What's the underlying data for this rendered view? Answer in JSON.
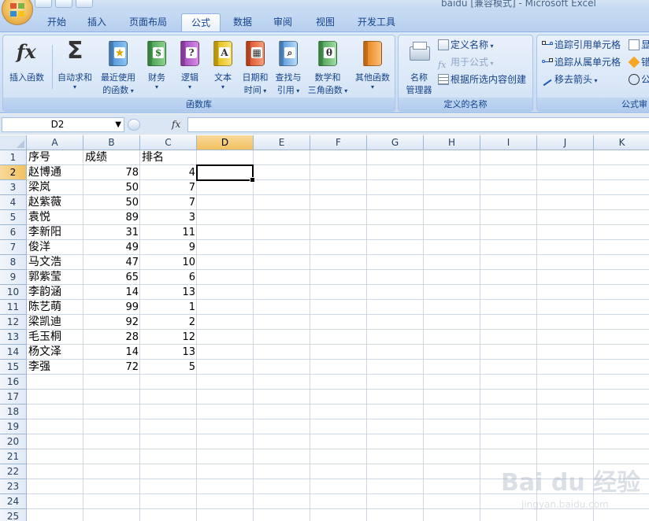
{
  "window": {
    "title": "baidu  [兼容模式] - Microsoft Excel"
  },
  "tabs": [
    {
      "label": "开始"
    },
    {
      "label": "插入"
    },
    {
      "label": "页面布局"
    },
    {
      "label": "公式",
      "active": true
    },
    {
      "label": "数据"
    },
    {
      "label": "审阅"
    },
    {
      "label": "视图"
    },
    {
      "label": "开发工具"
    }
  ],
  "ribbon": {
    "function_library": {
      "label": "函数库",
      "insert_function": "插入函数",
      "autosum": [
        "自动求和"
      ],
      "recently_used": [
        "最近使用",
        "的函数"
      ],
      "financial": [
        "财务"
      ],
      "logical": [
        "逻辑"
      ],
      "text": [
        "文本"
      ],
      "datetime": [
        "日期和",
        "时间"
      ],
      "lookup": [
        "查找与",
        "引用"
      ],
      "math": [
        "数学和",
        "三角函数"
      ],
      "more": [
        "其他函数"
      ]
    },
    "defined_names": {
      "label": "定义的名称",
      "name_manager": [
        "名称",
        "管理器"
      ],
      "define_name": "定义名称",
      "use_in_formula": "用于公式",
      "create_from_selection": "根据所选内容创建"
    },
    "formula_auditing": {
      "label": "公式审",
      "trace_precedents": "追踪引用单元格",
      "trace_dependents": "追踪从属单元格",
      "remove_arrows": "移去箭头",
      "show_formulas": "显",
      "error_checking": "错",
      "evaluate": "公"
    }
  },
  "formula_bar": {
    "name_box": "D2",
    "fx": "fx",
    "formula": ""
  },
  "columns": [
    "A",
    "B",
    "C",
    "D",
    "E",
    "F",
    "G",
    "H",
    "I",
    "J",
    "K"
  ],
  "selected_column": "D",
  "selected_row": 2,
  "row_count": 25,
  "table": {
    "headers": [
      "序号",
      "成绩",
      "排名"
    ],
    "rows": [
      [
        "赵博通",
        "78",
        "4"
      ],
      [
        "梁岚",
        "50",
        "7"
      ],
      [
        "赵紫薇",
        "50",
        "7"
      ],
      [
        "袁悦",
        "89",
        "3"
      ],
      [
        "李新阳",
        "31",
        "11"
      ],
      [
        "俊洋",
        "49",
        "9"
      ],
      [
        "马文浩",
        "47",
        "10"
      ],
      [
        "郭紫莹",
        "65",
        "6"
      ],
      [
        "李韵涵",
        "14",
        "13"
      ],
      [
        "陈艺萌",
        "99",
        "1"
      ],
      [
        "梁凯迪",
        "92",
        "2"
      ],
      [
        "毛玉桐",
        "28",
        "12"
      ],
      [
        "杨文泽",
        "14",
        "13"
      ],
      [
        "李强",
        "72",
        "5"
      ]
    ]
  },
  "watermark": {
    "main": "Bai du 经验",
    "sub": "jingyan.baidu.com"
  }
}
